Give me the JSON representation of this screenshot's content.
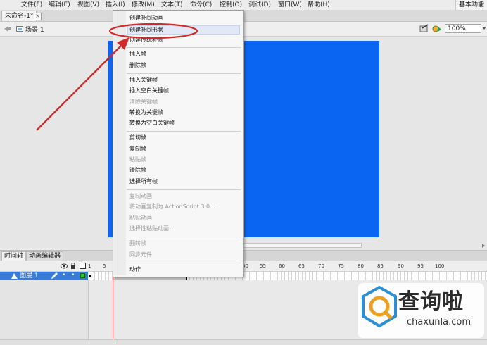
{
  "menubar": {
    "items": [
      "文件(F)",
      "编辑(E)",
      "视图(V)",
      "插入(I)",
      "修改(M)",
      "文本(T)",
      "命令(C)",
      "控制(O)",
      "调试(D)",
      "窗口(W)",
      "帮助(H)"
    ],
    "workspace": "基本功能"
  },
  "document": {
    "tab_title": "未命名-1*",
    "tab_close": "×",
    "scene": "场景 1",
    "zoom": "100%"
  },
  "timeline": {
    "tabs": [
      "时间轴",
      "动画编辑器"
    ],
    "layer_name": "图层 1",
    "frame_numbers": [
      "1",
      "5",
      "50",
      "55",
      "60",
      "65",
      "70",
      "75",
      "80",
      "85",
      "90",
      "95",
      "100"
    ]
  },
  "context_menu": {
    "items": [
      {
        "label": "创建补间动画",
        "enabled": true
      },
      {
        "label": "创建补间形状",
        "enabled": true
      },
      {
        "label": "创建传统补间",
        "enabled": true
      },
      {
        "label": "插入帧",
        "enabled": true
      },
      {
        "label": "删除帧",
        "enabled": true
      },
      {
        "label": "插入关键帧",
        "enabled": true
      },
      {
        "label": "插入空白关键帧",
        "enabled": true
      },
      {
        "label": "清除关键帧",
        "enabled": false
      },
      {
        "label": "转换为关键帧",
        "enabled": true
      },
      {
        "label": "转换为空白关键帧",
        "enabled": true
      },
      {
        "label": "剪切帧",
        "enabled": true
      },
      {
        "label": "复制帧",
        "enabled": true
      },
      {
        "label": "粘贴帧",
        "enabled": false
      },
      {
        "label": "清除帧",
        "enabled": true
      },
      {
        "label": "选择所有帧",
        "enabled": true
      },
      {
        "label": "复制动画",
        "enabled": false
      },
      {
        "label": "将动画复制为 ActionScript 3.0...",
        "enabled": false
      },
      {
        "label": "粘贴动画",
        "enabled": false
      },
      {
        "label": "选择性粘贴动画...",
        "enabled": false
      },
      {
        "label": "翻转帧",
        "enabled": false
      },
      {
        "label": "同步元件",
        "enabled": false
      },
      {
        "label": "动作",
        "enabled": true
      }
    ]
  },
  "watermark": {
    "title": "查询啦",
    "url": "chaxunla.com"
  },
  "colors": {
    "stage": "#0a66f2",
    "annotation": "#d42a2a",
    "layer_selected": "#3a7bd5",
    "playhead": "#e03030"
  }
}
